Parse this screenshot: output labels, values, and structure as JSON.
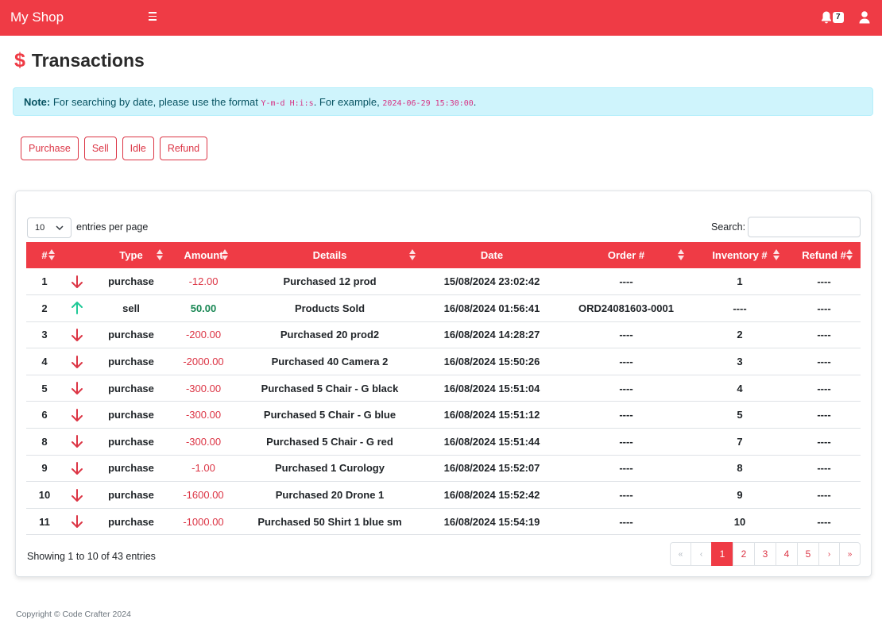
{
  "app": {
    "brand": "My Shop",
    "notification_count": "7"
  },
  "page": {
    "title": "Transactions"
  },
  "note": {
    "label": "Note:",
    "text1": "For searching by date, please use the format",
    "format": "Y-m-d H:i:s",
    "text2": ". For example,",
    "example": "2024-06-29 15:30:00",
    "text3": "."
  },
  "filters": [
    "Purchase",
    "Sell",
    "Idle",
    "Refund"
  ],
  "table_controls": {
    "length_value": "10",
    "entries_label": "entries per page",
    "search_label": "Search:"
  },
  "columns": [
    "#",
    "",
    "Type",
    "Amount",
    "Details",
    "Date",
    "Order #",
    "Inventory #",
    "Refund #"
  ],
  "rows": [
    {
      "id": "1",
      "direction": "down",
      "type": "purchase",
      "amount": "-12.00",
      "details": "Purchased 12 prod",
      "date": "15/08/2024 23:02:42",
      "order": "----",
      "inventory": "1",
      "refund": "----"
    },
    {
      "id": "2",
      "direction": "up",
      "type": "sell",
      "amount": "50.00",
      "details": "Products Sold",
      "date": "16/08/2024 01:56:41",
      "order": "ORD24081603-0001",
      "inventory": "----",
      "refund": "----"
    },
    {
      "id": "3",
      "direction": "down",
      "type": "purchase",
      "amount": "-200.00",
      "details": "Purchased 20 prod2",
      "date": "16/08/2024 14:28:27",
      "order": "----",
      "inventory": "2",
      "refund": "----"
    },
    {
      "id": "4",
      "direction": "down",
      "type": "purchase",
      "amount": "-2000.00",
      "details": "Purchased 40 Camera 2",
      "date": "16/08/2024 15:50:26",
      "order": "----",
      "inventory": "3",
      "refund": "----"
    },
    {
      "id": "5",
      "direction": "down",
      "type": "purchase",
      "amount": "-300.00",
      "details": "Purchased 5 Chair - G black",
      "date": "16/08/2024 15:51:04",
      "order": "----",
      "inventory": "4",
      "refund": "----"
    },
    {
      "id": "6",
      "direction": "down",
      "type": "purchase",
      "amount": "-300.00",
      "details": "Purchased 5 Chair - G blue",
      "date": "16/08/2024 15:51:12",
      "order": "----",
      "inventory": "5",
      "refund": "----"
    },
    {
      "id": "8",
      "direction": "down",
      "type": "purchase",
      "amount": "-300.00",
      "details": "Purchased 5 Chair - G red",
      "date": "16/08/2024 15:51:44",
      "order": "----",
      "inventory": "7",
      "refund": "----"
    },
    {
      "id": "9",
      "direction": "down",
      "type": "purchase",
      "amount": "-1.00",
      "details": "Purchased 1 Curology",
      "date": "16/08/2024 15:52:07",
      "order": "----",
      "inventory": "8",
      "refund": "----"
    },
    {
      "id": "10",
      "direction": "down",
      "type": "purchase",
      "amount": "-1600.00",
      "details": "Purchased 20 Drone 1",
      "date": "16/08/2024 15:52:42",
      "order": "----",
      "inventory": "9",
      "refund": "----"
    },
    {
      "id": "11",
      "direction": "down",
      "type": "purchase",
      "amount": "-1000.00",
      "details": "Purchased 50 Shirt 1 blue sm",
      "date": "16/08/2024 15:54:19",
      "order": "----",
      "inventory": "10",
      "refund": "----"
    }
  ],
  "info": "Showing 1 to 10 of 43 entries",
  "pagination": {
    "first": "«",
    "prev": "‹",
    "pages": [
      "1",
      "2",
      "3",
      "4",
      "5"
    ],
    "active": "1",
    "next": "›",
    "last": "»"
  },
  "footer": "Copyright © Code Crafter 2024",
  "colors": {
    "accent": "#ef3b45",
    "negative": "#dc3545",
    "positive": "#198754",
    "up_arrow": "#20c997"
  }
}
